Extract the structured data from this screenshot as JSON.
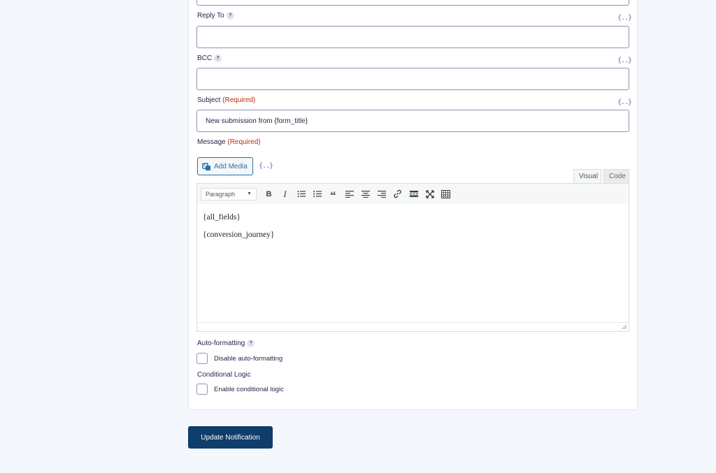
{
  "fields": {
    "reply_to": {
      "label": "Reply To",
      "help": "?",
      "merge_tag": "{..}",
      "value": ""
    },
    "bcc": {
      "label": "BCC",
      "help": "?",
      "merge_tag": "{..}",
      "value": ""
    },
    "subject": {
      "label": "Subject",
      "required": "(Required)",
      "merge_tag": "{..}",
      "value": "New submission from {form_title}"
    },
    "message": {
      "label": "Message",
      "required": "(Required)",
      "merge_tag": "{..}"
    }
  },
  "editor": {
    "add_media_label": "Add Media",
    "tabs": {
      "visual": "Visual",
      "code": "Code"
    },
    "format_select": "Paragraph",
    "toolbar_icons": [
      "bold-icon",
      "italic-icon",
      "bullet-list-icon",
      "numbered-list-icon",
      "blockquote-icon",
      "align-left-icon",
      "align-center-icon",
      "align-right-icon",
      "link-icon",
      "read-more-icon",
      "fullscreen-icon",
      "toolbar-toggle-icon"
    ],
    "content": [
      "{all_fields}",
      "{conversion_journey}"
    ]
  },
  "auto_formatting": {
    "label": "Auto-formatting",
    "help": "?",
    "checkbox_label": "Disable auto-formatting",
    "checked": false
  },
  "conditional_logic": {
    "label": "Conditional Logic",
    "checkbox_label": "Enable conditional logic",
    "checked": false
  },
  "update_button": "Update Notification",
  "colors": {
    "primary_button": "#0f3d6c",
    "required": "#c02b0a",
    "input_border": "#9092b2",
    "merge_tag": "#5a67b3"
  }
}
